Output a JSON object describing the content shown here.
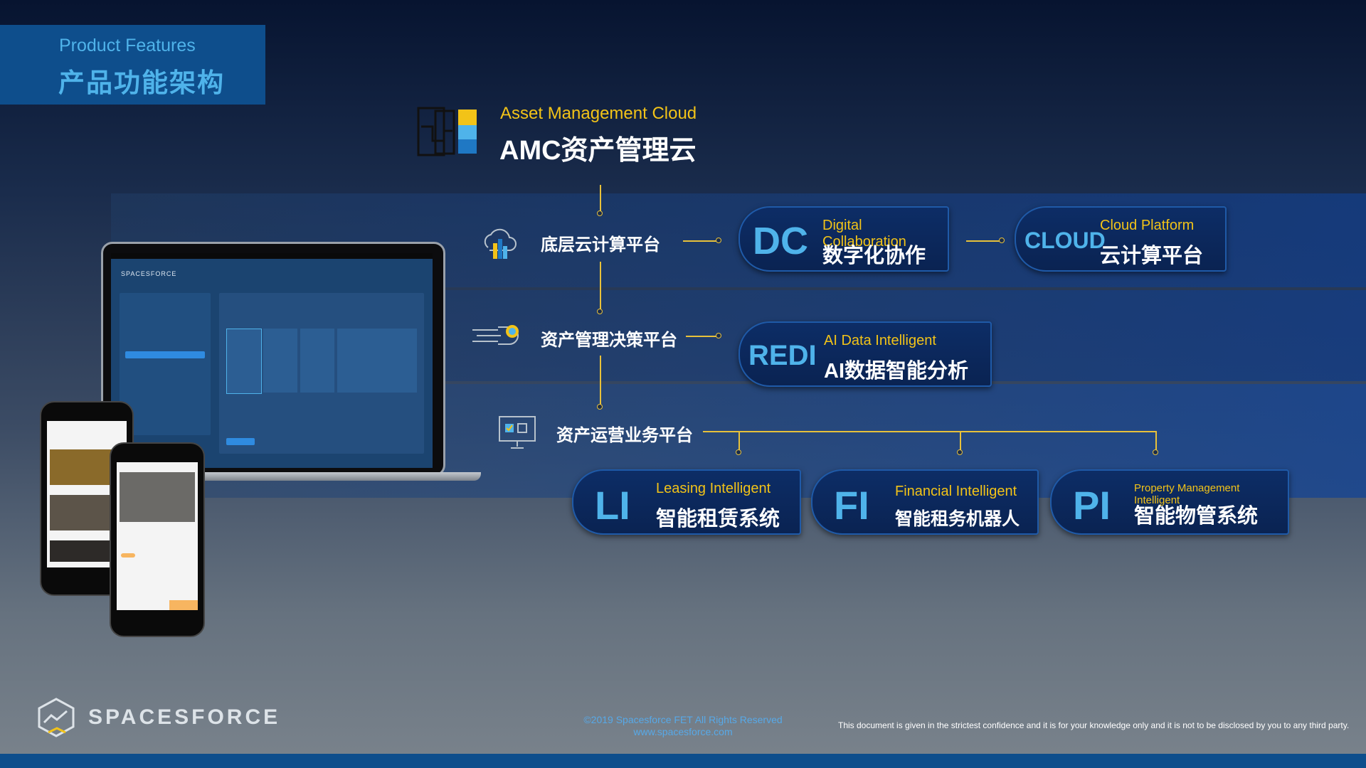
{
  "title": {
    "en": "Product Features",
    "zh": "产品功能架构"
  },
  "amc": {
    "en": "Asset Management Cloud",
    "zh": "AMC资产管理云"
  },
  "layers": [
    {
      "label": "底层云计算平台",
      "icon": "cloud-chart-icon"
    },
    {
      "label": "资产管理决策平台",
      "icon": "pointing-hand-icon"
    },
    {
      "label": "资产运营业务平台",
      "icon": "monitor-icon"
    }
  ],
  "modules": {
    "dc": {
      "abbr": "DC",
      "en": "Digital Collaboration",
      "zh": "数字化协作"
    },
    "cloud": {
      "abbr": "CLOUD",
      "en": "Cloud Platform",
      "zh": "云计算平台"
    },
    "redi": {
      "abbr": "REDI",
      "en": "AI Data Intelligent",
      "zh": "AI数据智能分析"
    },
    "li": {
      "abbr": "LI",
      "en": "Leasing Intelligent",
      "zh": "智能租赁系统"
    },
    "fi": {
      "abbr": "FI",
      "en": "Financial Intelligent",
      "zh": "智能租务机器人"
    },
    "pi": {
      "abbr": "PI",
      "en": "Property Management Intelligent",
      "zh": "智能物管系统"
    }
  },
  "laptop": {
    "brand": "SPACESFORCE"
  },
  "colors": {
    "accent_blue": "#4fb3ea",
    "accent_yellow": "#f2c318",
    "line": "#e8c13a"
  },
  "footer": {
    "logo": "SPACESFORCE",
    "copyright": "©2019 Spacesforce FET All Rights Reserved",
    "website": "www.spacesforce.com",
    "disclaimer": "This document is given in the strictest confidence and it is for your knowledge only and it is not to be disclosed by you to any third party."
  }
}
